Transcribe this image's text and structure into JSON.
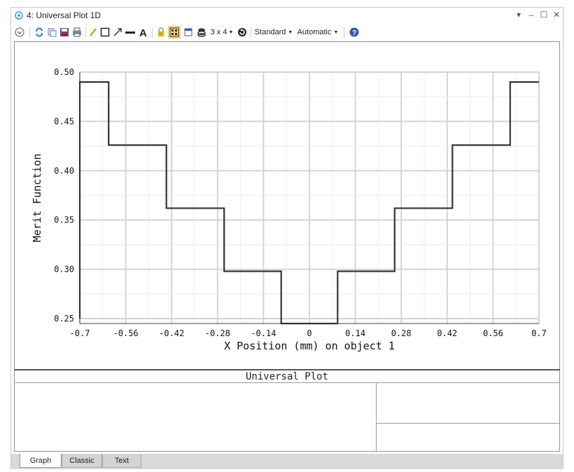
{
  "window": {
    "title": "4: Universal Plot 1D",
    "controls": [
      "▾",
      "‒",
      "☐",
      "✕"
    ]
  },
  "toolbar": {
    "layout_label": "3 x 4",
    "standard_label": "Standard",
    "automatic_label": "Automatic"
  },
  "chart_data": {
    "type": "line",
    "xlabel": "X Position (mm) on object 1",
    "ylabel": "Merit Function",
    "xlim": [
      -0.7,
      0.7
    ],
    "ylim": [
      0.245,
      0.5
    ],
    "x_ticks": [
      "-0.7",
      "-0.56",
      "-0.42",
      "-0.28",
      "-0.14",
      "0",
      "0.14",
      "0.28",
      "0.42",
      "0.56",
      "0.7"
    ],
    "y_ticks": [
      "0.50",
      "0.45",
      "0.40",
      "0.35",
      "0.30",
      "0.25"
    ],
    "grid": true,
    "series": [
      {
        "x": [
          -0.7,
          -0.7,
          -0.612,
          -0.612,
          -0.436,
          -0.436,
          -0.26,
          -0.26,
          -0.086,
          -0.086,
          0.086,
          0.086,
          0.26,
          0.26,
          0.436,
          0.436,
          0.612,
          0.612,
          0.7
        ],
        "y": [
          0.25,
          0.49,
          0.49,
          0.426,
          0.426,
          0.362,
          0.362,
          0.298,
          0.298,
          0.245,
          0.245,
          0.298,
          0.298,
          0.362,
          0.362,
          0.426,
          0.426,
          0.49,
          0.49
        ]
      }
    ]
  },
  "footer": {
    "title": "Universal Plot"
  },
  "tabs": [
    "Graph",
    "Classic",
    "Text"
  ]
}
